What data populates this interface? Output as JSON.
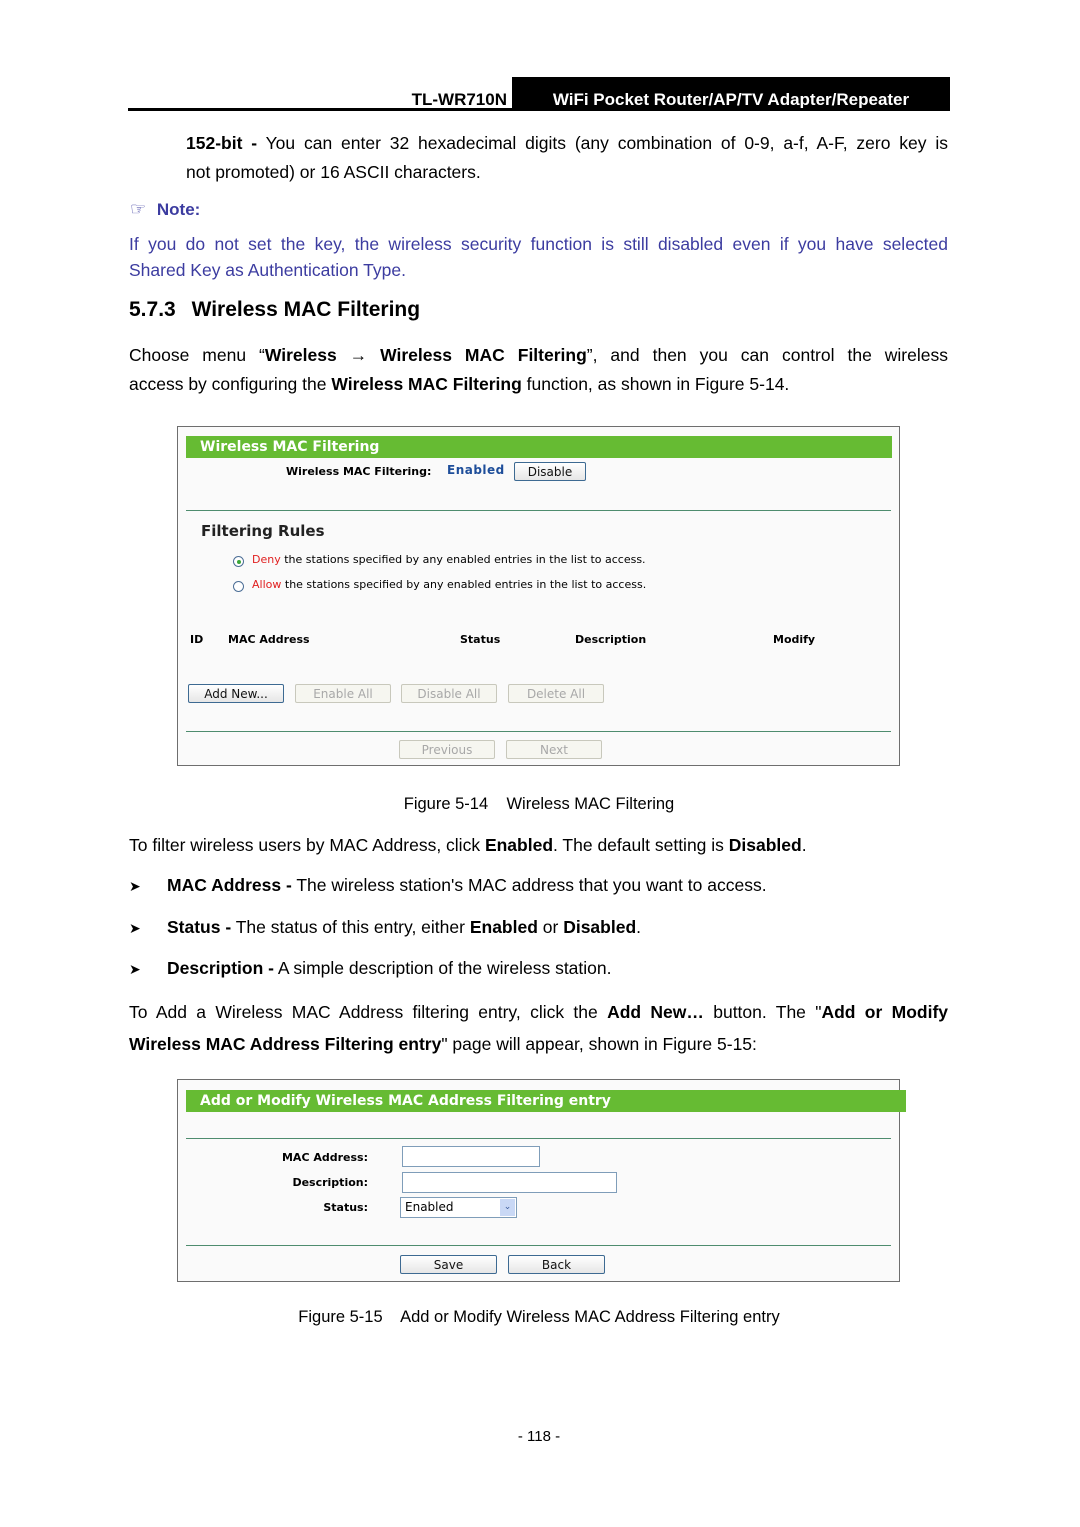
{
  "header": {
    "model": "TL-WR710N",
    "product": "WiFi Pocket Router/AP/TV Adapter/Repeater"
  },
  "intro": {
    "term": "152-bit -",
    "text_line1": "You can enter 32 hexadecimal digits (any combination of 0-9, a-f, A-F, zero key is",
    "text_line2": "not promoted) or 16 ASCII characters."
  },
  "note": {
    "icon": "pointing-hand-icon",
    "label": "Note:",
    "line1": "If you do not set the key, the wireless security function is still disabled even if you have selected",
    "line2": "Shared Key as Authentication Type."
  },
  "section": {
    "number": "5.7.3",
    "title": "Wireless MAC Filtering",
    "para1_a": "Choose menu “",
    "para1_b1": "Wireless",
    "arrow": "→",
    "para1_b2": "Wireless MAC Filtering",
    "para1_c": "”, and then you can control the wireless",
    "para1_line2_a": "access by configuring the ",
    "para1_line2_b": "Wireless MAC Filtering",
    "para1_line2_c": " function, as shown in Figure 5-14."
  },
  "figure14": {
    "title": "Wireless MAC Filtering",
    "status_label": "Wireless MAC Filtering:",
    "status_value": "Enabled",
    "toggle_button": "Disable",
    "rules_title": "Filtering Rules",
    "rule_deny_keyword": "Deny",
    "rule_deny_text": "the stations specified by any enabled entries in the list to access.",
    "rule_allow_keyword": "Allow",
    "rule_allow_text": "the stations specified by any enabled entries in the list to access.",
    "selected_rule": "Deny",
    "columns": [
      "ID",
      "MAC Address",
      "Status",
      "Description",
      "Modify"
    ],
    "buttons": [
      "Add New...",
      "Enable All",
      "Disable All",
      "Delete All"
    ],
    "nav_buttons": [
      "Previous",
      "Next"
    ],
    "caption": "Figure 5-14    Wireless MAC Filtering"
  },
  "body2": {
    "line1_a": "To filter wireless users by MAC Address, click ",
    "line1_b": "Enabled",
    "line1_c": ". The default setting is ",
    "line1_d": "Disabled",
    "line1_e": ".",
    "bullets": [
      {
        "term": "MAC Address -",
        "text": " The wireless station's MAC address that you want to access."
      },
      {
        "term": "Status -",
        "text": " The status of this entry, either ",
        "b1": "Enabled",
        "mid": " or ",
        "b2": "Disabled",
        "end": "."
      },
      {
        "term": "Description -",
        "text": " A simple description of the wireless station."
      }
    ],
    "para_a": "To Add a Wireless MAC Address filtering entry, click the ",
    "para_b": "Add New…",
    "para_c": " button. The \"",
    "para_d": "Add or Modify",
    "para_e": "Wireless MAC Address Filtering entry",
    "para_f": "\" page will appear, shown in Figure 5-15:"
  },
  "figure15": {
    "title": "Add or Modify Wireless MAC Address Filtering entry",
    "mac_label": "MAC Address:",
    "mac_value": "",
    "desc_label": "Description:",
    "desc_value": "",
    "status_label": "Status:",
    "status_value": "Enabled",
    "save_button": "Save",
    "back_button": "Back",
    "caption": "Figure 5-15    Add or Modify Wireless MAC Address Filtering entry"
  },
  "footer": {
    "page_number": "- 118 -"
  }
}
